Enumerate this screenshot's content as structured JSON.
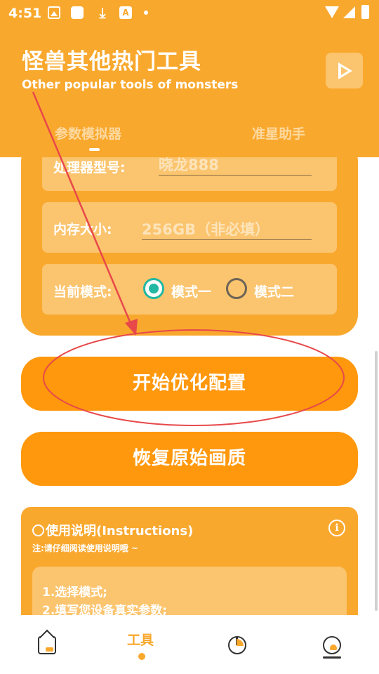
{
  "status_bar": {
    "time": "4:51",
    "icons": [
      "photo-icon",
      "app-square-icon",
      "download-icon",
      "a-text-icon",
      "dot-icon",
      "wifi-icon",
      "signal-icon",
      "battery-icon"
    ]
  },
  "header": {
    "title": "怪兽其他热门工具",
    "subtitle": "Other popular tools of monsters",
    "play_icon": "play-triangle-icon",
    "tabs": [
      {
        "label": "参数模拟器",
        "active": true
      },
      {
        "label": "准星助手",
        "active": false
      }
    ]
  },
  "form": {
    "processor_label": "处理器型号:",
    "processor_placeholder": "晓龙888",
    "memory_label": "内存大小:",
    "memory_placeholder": "256GB（非必填）",
    "mode_label": "当前模式:",
    "modes": [
      {
        "label": "模式一",
        "selected": true
      },
      {
        "label": "模式二",
        "selected": false
      }
    ]
  },
  "actions": {
    "start_label": "开始优化配置",
    "restore_label": "恢复原始画质"
  },
  "instructions": {
    "title": "使用说明(Instructions)",
    "note": "注:请仔细阅读使用说明哦 ~",
    "steps": [
      "1.选择模式;",
      "2.填写您设备真实参数;"
    ]
  },
  "bottom_nav": {
    "items": [
      {
        "icon": "home-icon",
        "label": ""
      },
      {
        "icon": "",
        "label": "工具",
        "active": true
      },
      {
        "icon": "chart-icon",
        "label": ""
      },
      {
        "icon": "profile-icon",
        "label": ""
      }
    ]
  },
  "colors": {
    "primary": "#F9A82E",
    "button": "#FF980C",
    "field": "#FBC46E",
    "radio_selected": "#22B8A3",
    "annotation": "#E8484A"
  }
}
